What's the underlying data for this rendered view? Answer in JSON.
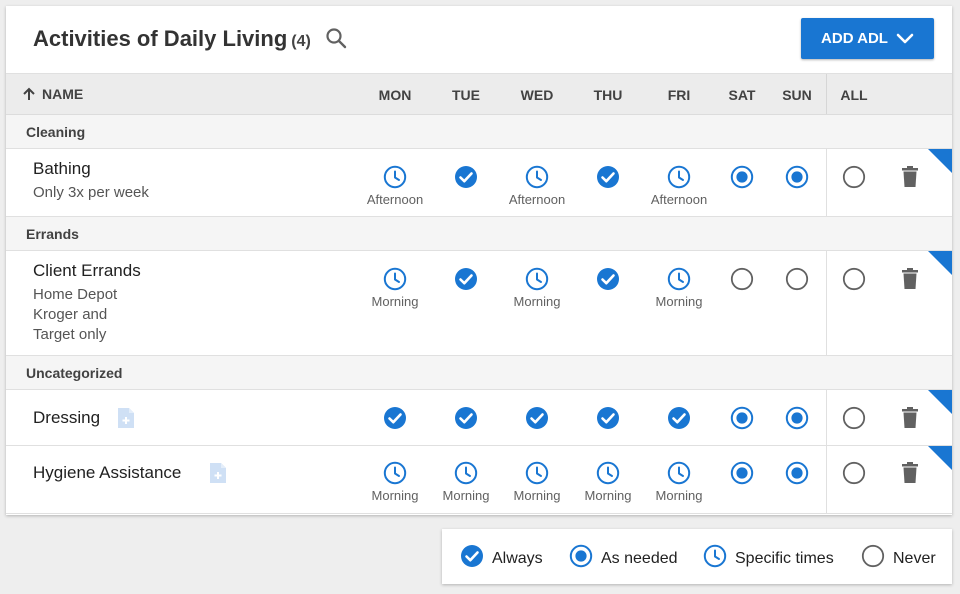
{
  "header": {
    "title": "Activities of Daily Living",
    "count": "(4)",
    "add_button_label": "ADD ADL"
  },
  "columns": {
    "name": "NAME",
    "days": [
      "MON",
      "TUE",
      "WED",
      "THU",
      "FRI",
      "SAT",
      "SUN"
    ],
    "all": "ALL"
  },
  "colors": {
    "accent": "#1976d2",
    "icon_gray": "#616161",
    "note_icon": "#cfe0f5"
  },
  "groups": [
    {
      "name": "Cleaning",
      "rows": [
        {
          "name": "Bathing",
          "notes": [
            "Only 3x per week"
          ],
          "days": [
            {
              "state": "specific",
              "label": "Afternoon"
            },
            {
              "state": "always",
              "label": ""
            },
            {
              "state": "specific",
              "label": "Afternoon"
            },
            {
              "state": "always",
              "label": ""
            },
            {
              "state": "specific",
              "label": "Afternoon"
            },
            {
              "state": "as_needed",
              "label": ""
            },
            {
              "state": "as_needed",
              "label": ""
            }
          ],
          "all": "never",
          "has_note_icon": false
        }
      ]
    },
    {
      "name": "Errands",
      "rows": [
        {
          "name": "Client Errands",
          "notes": [
            "Home Depot",
            "Kroger and",
            "Target only"
          ],
          "days": [
            {
              "state": "specific",
              "label": "Morning"
            },
            {
              "state": "always",
              "label": ""
            },
            {
              "state": "specific",
              "label": "Morning"
            },
            {
              "state": "always",
              "label": ""
            },
            {
              "state": "specific",
              "label": "Morning"
            },
            {
              "state": "never",
              "label": ""
            },
            {
              "state": "never",
              "label": ""
            }
          ],
          "all": "never",
          "has_note_icon": false
        }
      ]
    },
    {
      "name": "Uncategorized",
      "rows": [
        {
          "name": "Dressing",
          "notes": [],
          "days": [
            {
              "state": "always",
              "label": ""
            },
            {
              "state": "always",
              "label": ""
            },
            {
              "state": "always",
              "label": ""
            },
            {
              "state": "always",
              "label": ""
            },
            {
              "state": "always",
              "label": ""
            },
            {
              "state": "as_needed",
              "label": ""
            },
            {
              "state": "as_needed",
              "label": ""
            }
          ],
          "all": "never",
          "has_note_icon": true
        },
        {
          "name": "Hygiene Assistance",
          "notes": [],
          "days": [
            {
              "state": "specific",
              "label": "Morning"
            },
            {
              "state": "specific",
              "label": "Morning"
            },
            {
              "state": "specific",
              "label": "Morning"
            },
            {
              "state": "specific",
              "label": "Morning"
            },
            {
              "state": "specific",
              "label": "Morning"
            },
            {
              "state": "as_needed",
              "label": ""
            },
            {
              "state": "as_needed",
              "label": ""
            }
          ],
          "all": "never",
          "has_note_icon": true
        }
      ]
    }
  ],
  "legend": [
    {
      "state": "always",
      "label": "Always"
    },
    {
      "state": "as_needed",
      "label": "As needed"
    },
    {
      "state": "specific",
      "label": "Specific times"
    },
    {
      "state": "never",
      "label": "Never"
    }
  ]
}
